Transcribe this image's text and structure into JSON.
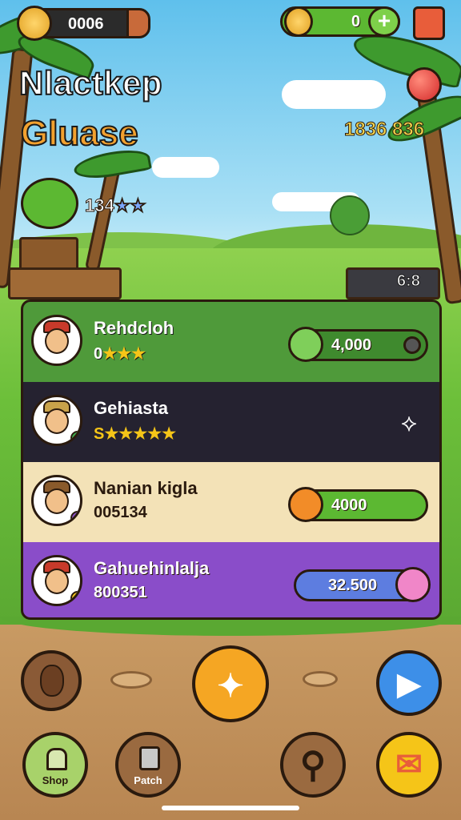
{
  "hud": {
    "coins": "0006",
    "energy": "0",
    "add_button": "+",
    "resource_counter": "1836 836"
  },
  "title": {
    "line1": "Nlactkep",
    "line2": "Gluase"
  },
  "profile": {
    "stats": "134",
    "stars": "★★"
  },
  "side_counter": "6:8",
  "leaderboard": [
    {
      "name": "Rehdcloh",
      "sub_prefix": "0",
      "stars": "★★★",
      "reward": "4,000",
      "reward_icon": "leaf-icon"
    },
    {
      "name": "Gehiasta",
      "sub_prefix": "S",
      "stars": "★★★★★",
      "reward": "",
      "reward_icon": "compass-icon"
    },
    {
      "name": "Nanian kigla",
      "sub_prefix": "005134",
      "stars": "",
      "reward": "4000",
      "reward_icon": "orange-icon"
    },
    {
      "name": "Gahuehinlalja",
      "sub_prefix": "800351",
      "stars": "",
      "reward": "32.500",
      "reward_icon": "pink-hair-avatar-icon"
    }
  ],
  "bottom_nav": {
    "shop_label": "Shop",
    "robot_label": "Patch",
    "center_glyph": "✦",
    "play_glyph": "▶",
    "search_glyph": "⚲",
    "mail_glyph": "✉"
  },
  "colors": {
    "row1": "#4f9a3a",
    "row2": "#252230",
    "row3": "#f3e2b7",
    "row4": "#8a4dc9",
    "accent_orange": "#f5a623",
    "accent_blue": "#3d8fe8"
  }
}
